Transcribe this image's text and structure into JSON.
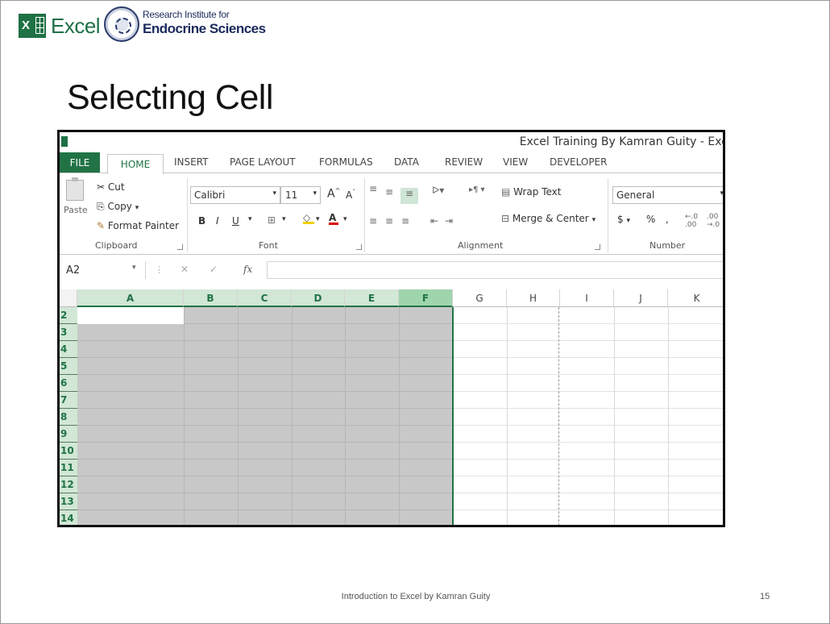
{
  "header": {
    "app_logo_text": "Excel",
    "institute_line1": "Research Institute for",
    "institute_line2": "Endocrine Sciences"
  },
  "slide": {
    "title": "Selecting Cell",
    "footer": "Introduction to Excel by Kamran Guity",
    "page_number": "15"
  },
  "excel": {
    "window_title": "Excel Training By Kamran Guity - Exc",
    "tabs": [
      "FILE",
      "HOME",
      "INSERT",
      "PAGE LAYOUT",
      "FORMULAS",
      "DATA",
      "REVIEW",
      "VIEW",
      "DEVELOPER"
    ],
    "clipboard": {
      "paste": "Paste",
      "cut": "Cut",
      "copy": "Copy",
      "format_painter": "Format Painter",
      "group": "Clipboard"
    },
    "font": {
      "name": "Calibri",
      "size": "11",
      "group": "Font",
      "bold": "B",
      "italic": "I",
      "underline": "U"
    },
    "alignment": {
      "wrap_text": "Wrap Text",
      "merge_center": "Merge & Center",
      "group": "Alignment"
    },
    "number": {
      "format": "General",
      "currency": "$",
      "percent": "%",
      "comma": ",",
      "group": "Number"
    },
    "formula_bar": {
      "name_box": "A2",
      "fx": "fx",
      "value": ""
    },
    "columns": [
      "A",
      "B",
      "C",
      "D",
      "E",
      "F",
      "G",
      "H",
      "I",
      "J",
      "K"
    ],
    "selected_columns": [
      "A",
      "B",
      "C",
      "D",
      "E",
      "F"
    ],
    "rows": [
      "2",
      "3",
      "4",
      "5",
      "6",
      "7",
      "8",
      "9",
      "10",
      "11",
      "12",
      "13",
      "14"
    ],
    "active_cell": "A2",
    "colors": {
      "excel_green": "#217346",
      "selection_gray": "#c8c8c8",
      "header_highlight": "#d2e7d6"
    }
  }
}
